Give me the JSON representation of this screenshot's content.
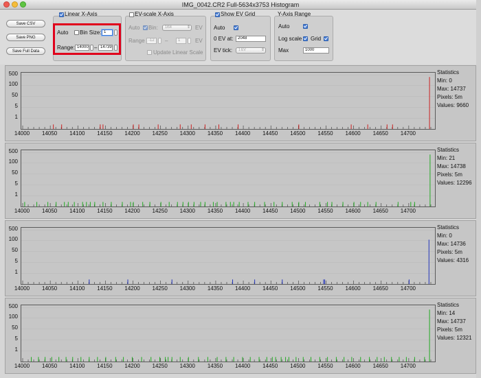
{
  "window": {
    "title": "IMG_0042.CR2 Full-5634x3753 Histogram"
  },
  "buttons": {
    "save_csv": "Save CSV",
    "save_png": "Save PNG",
    "save_full": "Save Full Data"
  },
  "linear": {
    "title": "Linear X-Axis",
    "auto": "Auto",
    "bin_size_label": "Bin Size:",
    "bin_size": "1",
    "range_label": "Range:",
    "range_min": "14000",
    "range_sep": "–",
    "range_max": "14739"
  },
  "ev": {
    "title": "EV-scale X-Axis",
    "auto": "Auto",
    "bin_label": "Bin:",
    "bin_value": "1/64",
    "ev_unit": "EV",
    "range_label": "Range",
    "range_min": "-12",
    "range_sep": "–",
    "range_max": "1",
    "update_label": "Update Linear Scale"
  },
  "evgrid": {
    "title": "Show EV Grid",
    "auto": "Auto",
    "zero_label": "0 EV at:",
    "zero_value": "2048",
    "tick_label": "EV tick:",
    "tick_value": "1 EV"
  },
  "yaxis": {
    "title": "Y-Axis Range",
    "auto": "Auto",
    "log_label": "Log scale",
    "grid_label": "Grid",
    "max_label": "Max",
    "max_value": "1000"
  },
  "axes": {
    "y_ticks": [
      "500",
      "100",
      "50",
      "5",
      "1"
    ],
    "x_ticks": [
      "14000",
      "14050",
      "14100",
      "14150",
      "14200",
      "14250",
      "14300",
      "14350",
      "14400",
      "14450",
      "14500",
      "14550",
      "14600",
      "14650",
      "14700"
    ]
  },
  "stats_title": "Statistics",
  "chart_data": [
    {
      "type": "bar",
      "color": "#cc2222",
      "xlim": [
        14000,
        14745
      ],
      "y_scale": "log",
      "bars": [
        [
          14055,
          1
        ],
        [
          14070,
          1
        ],
        [
          14140,
          1
        ],
        [
          14145,
          1
        ],
        [
          14200,
          1
        ],
        [
          14210,
          1
        ],
        [
          14245,
          1
        ],
        [
          14285,
          1
        ],
        [
          14305,
          1
        ],
        [
          14330,
          1
        ],
        [
          14355,
          1
        ],
        [
          14390,
          1
        ],
        [
          14500,
          1
        ],
        [
          14595,
          1
        ],
        [
          14625,
          1
        ],
        [
          14660,
          1
        ],
        [
          14670,
          1
        ],
        [
          14737,
          500
        ]
      ],
      "stats": {
        "min": "Min: 0",
        "max": "Max: 14737",
        "pixels": "Pixels: 5m",
        "values": "Values: 9660"
      }
    },
    {
      "type": "bar",
      "color": "#22aa22",
      "xlim": [
        14000,
        14745
      ],
      "y_scale": "log",
      "bars": [
        [
          14003,
          1
        ],
        [
          14025,
          1
        ],
        [
          14045,
          1
        ],
        [
          14060,
          1
        ],
        [
          14075,
          1
        ],
        [
          14082,
          1
        ],
        [
          14093,
          1
        ],
        [
          14108,
          1
        ],
        [
          14115,
          1
        ],
        [
          14122,
          1
        ],
        [
          14130,
          1
        ],
        [
          14145,
          1
        ],
        [
          14160,
          1
        ],
        [
          14180,
          1
        ],
        [
          14195,
          1
        ],
        [
          14200,
          1
        ],
        [
          14217,
          1
        ],
        [
          14230,
          1
        ],
        [
          14250,
          1
        ],
        [
          14265,
          1
        ],
        [
          14280,
          1
        ],
        [
          14290,
          1
        ],
        [
          14300,
          1
        ],
        [
          14310,
          1
        ],
        [
          14322,
          1
        ],
        [
          14330,
          1
        ],
        [
          14345,
          1
        ],
        [
          14352,
          1
        ],
        [
          14368,
          1
        ],
        [
          14376,
          1
        ],
        [
          14382,
          1
        ],
        [
          14392,
          1
        ],
        [
          14408,
          1
        ],
        [
          14420,
          1
        ],
        [
          14438,
          1
        ],
        [
          14455,
          1
        ],
        [
          14470,
          1
        ],
        [
          14488,
          1
        ],
        [
          14500,
          1
        ],
        [
          14512,
          1
        ],
        [
          14538,
          1
        ],
        [
          14552,
          1
        ],
        [
          14560,
          1
        ],
        [
          14580,
          1
        ],
        [
          14600,
          1
        ],
        [
          14612,
          1
        ],
        [
          14625,
          1
        ],
        [
          14640,
          1
        ],
        [
          14680,
          1
        ],
        [
          14703,
          1
        ],
        [
          14710,
          1
        ],
        [
          14738,
          500
        ]
      ],
      "stats": {
        "min": "Min: 21",
        "max": "Max: 14738",
        "pixels": "Pixels: 5m",
        "values": "Values: 12296"
      }
    },
    {
      "type": "bar",
      "color": "#2233bb",
      "xlim": [
        14000,
        14745
      ],
      "y_scale": "log",
      "bars": [
        [
          14120,
          1
        ],
        [
          14190,
          1
        ],
        [
          14270,
          1
        ],
        [
          14380,
          1
        ],
        [
          14420,
          1
        ],
        [
          14470,
          1
        ],
        [
          14545,
          1
        ],
        [
          14547,
          1
        ],
        [
          14700,
          1
        ],
        [
          14736,
          200
        ]
      ],
      "stats": {
        "min": "Min: 0",
        "max": "Max: 14736",
        "pixels": "Pixels: 5m",
        "values": "Values: 4316"
      }
    },
    {
      "type": "bar",
      "color": "#22aa22",
      "xlim": [
        14000,
        14745
      ],
      "y_scale": "log",
      "bars": [
        [
          14015,
          1
        ],
        [
          14028,
          1
        ],
        [
          14040,
          1
        ],
        [
          14052,
          1
        ],
        [
          14065,
          1
        ],
        [
          14078,
          1
        ],
        [
          14090,
          1
        ],
        [
          14105,
          1
        ],
        [
          14120,
          1
        ],
        [
          14135,
          1
        ],
        [
          14150,
          1
        ],
        [
          14168,
          1
        ],
        [
          14182,
          1
        ],
        [
          14198,
          1
        ],
        [
          14215,
          1
        ],
        [
          14232,
          1
        ],
        [
          14248,
          1
        ],
        [
          14258,
          1
        ],
        [
          14263,
          1
        ],
        [
          14270,
          1
        ],
        [
          14285,
          1
        ],
        [
          14300,
          1
        ],
        [
          14318,
          1
        ],
        [
          14335,
          1
        ],
        [
          14352,
          1
        ],
        [
          14368,
          1
        ],
        [
          14382,
          1
        ],
        [
          14398,
          1
        ],
        [
          14412,
          1
        ],
        [
          14428,
          1
        ],
        [
          14442,
          1
        ],
        [
          14452,
          1
        ],
        [
          14458,
          1
        ],
        [
          14468,
          1
        ],
        [
          14476,
          1
        ],
        [
          14482,
          1
        ],
        [
          14495,
          1
        ],
        [
          14508,
          1
        ],
        [
          14522,
          1
        ],
        [
          14538,
          1
        ],
        [
          14552,
          1
        ],
        [
          14568,
          1
        ],
        [
          14582,
          1
        ],
        [
          14596,
          1
        ],
        [
          14612,
          1
        ],
        [
          14628,
          1
        ],
        [
          14642,
          1
        ],
        [
          14655,
          1
        ],
        [
          14668,
          1
        ],
        [
          14682,
          1
        ],
        [
          14695,
          1
        ],
        [
          14710,
          1
        ],
        [
          14728,
          1
        ],
        [
          14737,
          500
        ]
      ],
      "stats": {
        "min": "Min: 14",
        "max": "Max: 14737",
        "pixels": "Pixels: 5m",
        "values": "Values: 12321"
      }
    }
  ]
}
